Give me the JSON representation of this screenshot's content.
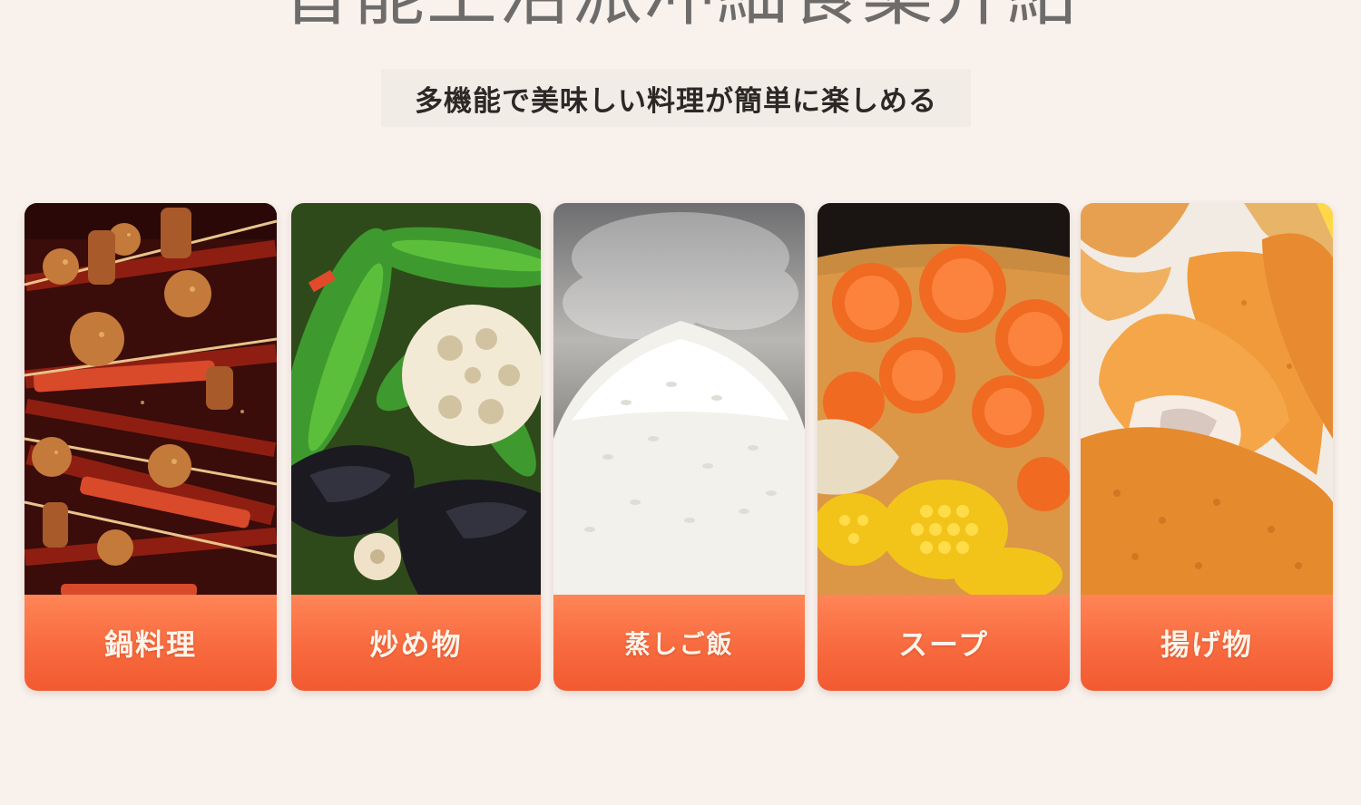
{
  "header": {
    "title": "智能土活派冲細食築介紹",
    "subtitle": "多機能で美味しい料理が簡単に楽しめる"
  },
  "dishes": [
    {
      "label": "鍋料理",
      "icon": "hotpot-skewers-photo"
    },
    {
      "label": "炒め物",
      "icon": "stir-fry-vegetables-photo"
    },
    {
      "label": "蒸しご飯",
      "icon": "steamed-rice-photo"
    },
    {
      "label": "スープ",
      "icon": "soup-carrot-corn-photo"
    },
    {
      "label": "揚げ物",
      "icon": "fried-fish-photo"
    }
  ],
  "colors": {
    "background": "#f8f1ec",
    "label_bar_top": "#ff8557",
    "label_bar_bottom": "#f25a30",
    "label_text": "#fff4ea"
  }
}
